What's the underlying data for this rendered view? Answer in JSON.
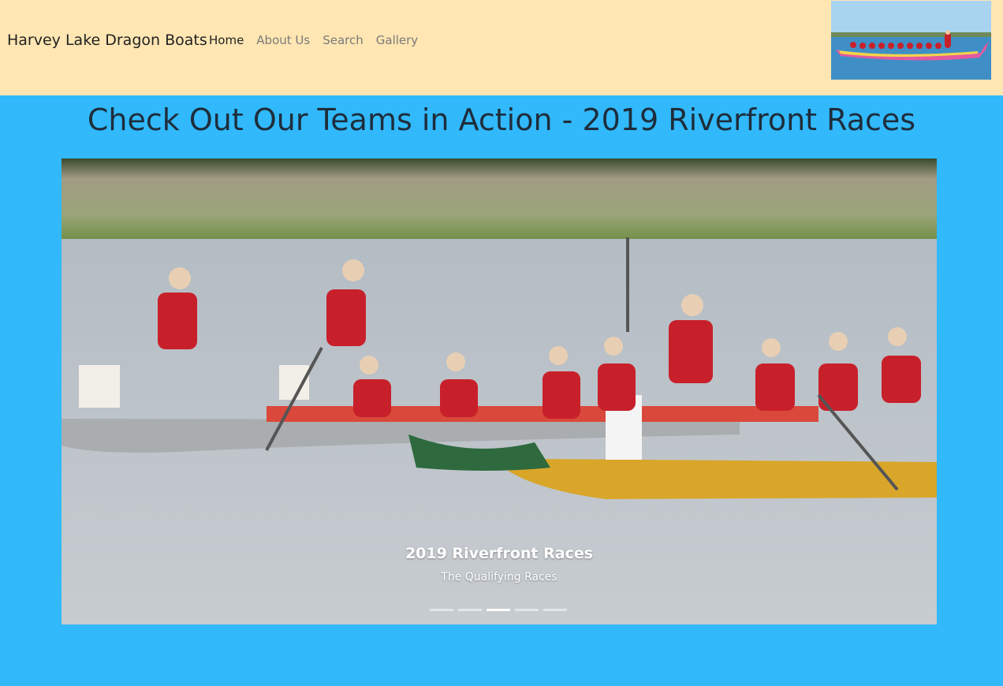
{
  "navbar": {
    "brand": "Harvey Lake Dragon Boats",
    "links": [
      {
        "label": "Home",
        "active": true
      },
      {
        "label": "About Us",
        "active": false
      },
      {
        "label": "Search",
        "active": false
      },
      {
        "label": "Gallery",
        "active": false
      }
    ],
    "background": "#ffe6b3"
  },
  "page": {
    "title": "Check Out Our Teams in Action - 2019 Riverfront Races",
    "background": "#31b9fc"
  },
  "carousel": {
    "caption_title": "2019 Riverfront Races",
    "caption_text": "The Qualifying Races",
    "slide_count": 5,
    "active_index": 2
  }
}
